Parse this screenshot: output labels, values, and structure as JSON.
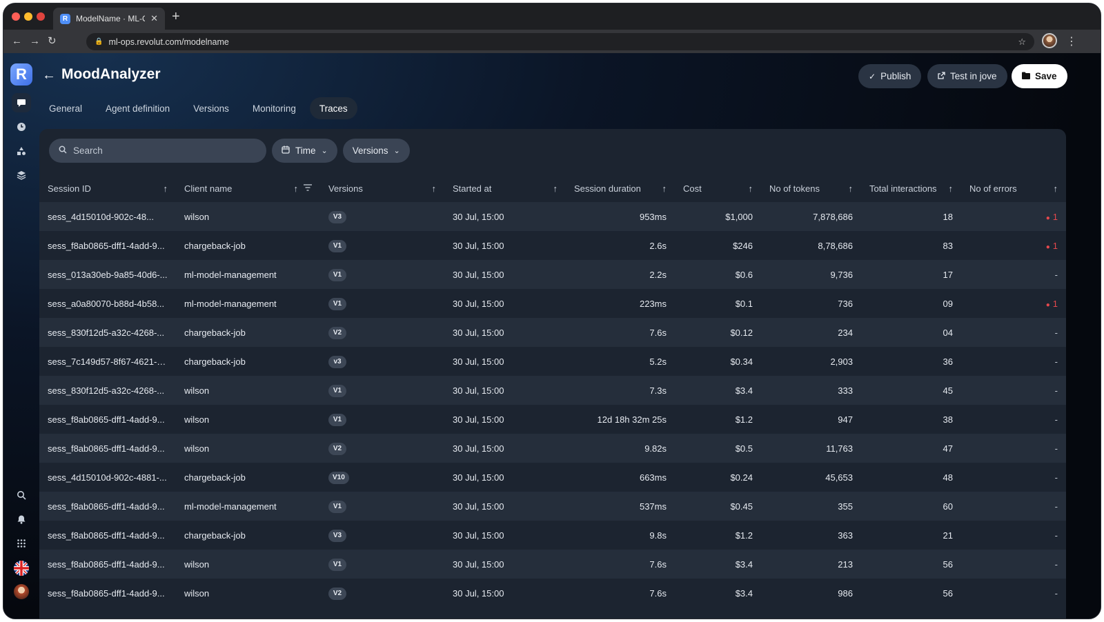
{
  "browser": {
    "tab_title": "ModelName · ML-Ops",
    "url": "ml-ops.revolut.com/modelname",
    "favicon_letter": "R"
  },
  "app": {
    "logo_letter": "R",
    "title": "MoodAnalyzer",
    "actions": {
      "publish": "Publish",
      "test": "Test in jove",
      "save": "Save"
    },
    "tabs": [
      "General",
      "Agent definition",
      "Versions",
      "Monitoring",
      "Traces"
    ],
    "active_tab": "Traces"
  },
  "filters": {
    "search_placeholder": "Search",
    "time_label": "Time",
    "versions_label": "Versions"
  },
  "table": {
    "columns": [
      "Session ID",
      "Client name",
      "Versions",
      "Started at",
      "Session duration",
      "Cost",
      "No of tokens",
      "Total interactions",
      "No of errors"
    ],
    "rows": [
      {
        "session": "sess_4d15010d-902c-48...",
        "client": "wilson",
        "version": "V3",
        "started": "30 Jul, 15:00",
        "duration": "953ms",
        "cost": "$1,000",
        "tokens": "7,878,686",
        "interactions": "18",
        "errors": "1"
      },
      {
        "session": "sess_f8ab0865-dff1-4add-9...",
        "client": "chargeback-job",
        "version": "V1",
        "started": "30 Jul, 15:00",
        "duration": "2.6s",
        "cost": "$246",
        "tokens": "8,78,686",
        "interactions": "83",
        "errors": "1"
      },
      {
        "session": "sess_013a30eb-9a85-40d6-...",
        "client": "ml-model-management",
        "version": "V1",
        "started": "30 Jul, 15:00",
        "duration": "2.2s",
        "cost": "$0.6",
        "tokens": "9,736",
        "interactions": "17",
        "errors": "-"
      },
      {
        "session": "sess_a0a80070-b88d-4b58...",
        "client": "ml-model-management",
        "version": "V1",
        "started": "30 Jul, 15:00",
        "duration": "223ms",
        "cost": "$0.1",
        "tokens": "736",
        "interactions": "09",
        "errors": "1"
      },
      {
        "session": "sess_830f12d5-a32c-4268-...",
        "client": "chargeback-job",
        "version": "V2",
        "started": "30 Jul, 15:00",
        "duration": "7.6s",
        "cost": "$0.12",
        "tokens": "234",
        "interactions": "04",
        "errors": "-"
      },
      {
        "session": "sess_7c149d57-8f67-4621-9...",
        "client": "chargeback-job",
        "version": "v3",
        "started": "30 Jul, 15:00",
        "duration": "5.2s",
        "cost": "$0.34",
        "tokens": "2,903",
        "interactions": "36",
        "errors": "-"
      },
      {
        "session": "sess_830f12d5-a32c-4268-...",
        "client": "wilson",
        "version": "V1",
        "started": "30 Jul, 15:00",
        "duration": "7.3s",
        "cost": "$3.4",
        "tokens": "333",
        "interactions": "45",
        "errors": "-"
      },
      {
        "session": "sess_f8ab0865-dff1-4add-9...",
        "client": "wilson",
        "version": "V1",
        "started": "30 Jul, 15:00",
        "duration": "12d 18h 32m 25s",
        "cost": "$1.2",
        "tokens": "947",
        "interactions": "38",
        "errors": "-"
      },
      {
        "session": "sess_f8ab0865-dff1-4add-9...",
        "client": "wilson",
        "version": "V2",
        "started": "30 Jul, 15:00",
        "duration": "9.82s",
        "cost": "$0.5",
        "tokens": "11,763",
        "interactions": "47",
        "errors": "-"
      },
      {
        "session": "sess_4d15010d-902c-4881-...",
        "client": "chargeback-job",
        "version": "V10",
        "started": "30 Jul, 15:00",
        "duration": "663ms",
        "cost": "$0.24",
        "tokens": "45,653",
        "interactions": "48",
        "errors": "-"
      },
      {
        "session": "sess_f8ab0865-dff1-4add-9...",
        "client": "ml-model-management",
        "version": "V1",
        "started": "30 Jul, 15:00",
        "duration": "537ms",
        "cost": "$0.45",
        "tokens": "355",
        "interactions": "60",
        "errors": "-"
      },
      {
        "session": "sess_f8ab0865-dff1-4add-9...",
        "client": "chargeback-job",
        "version": "V3",
        "started": "30 Jul, 15:00",
        "duration": "9.8s",
        "cost": "$1.2",
        "tokens": "363",
        "interactions": "21",
        "errors": "-"
      },
      {
        "session": "sess_f8ab0865-dff1-4add-9...",
        "client": "wilson",
        "version": "V1",
        "started": "30 Jul, 15:00",
        "duration": "7.6s",
        "cost": "$3.4",
        "tokens": "213",
        "interactions": "56",
        "errors": "-"
      },
      {
        "session": "sess_f8ab0865-dff1-4add-9...",
        "client": "wilson",
        "version": "V2",
        "started": "30 Jul, 15:00",
        "duration": "7.6s",
        "cost": "$3.4",
        "tokens": "986",
        "interactions": "56",
        "errors": "-"
      }
    ]
  },
  "colors": {
    "accent": "#4f8ff7",
    "error": "#e5484d",
    "panel": "#1c2430"
  },
  "icons": {
    "rail": [
      "chat-icon",
      "clock-icon",
      "shapes-icon",
      "layers-icon",
      "search-icon",
      "bell-icon",
      "grid-icon"
    ]
  }
}
